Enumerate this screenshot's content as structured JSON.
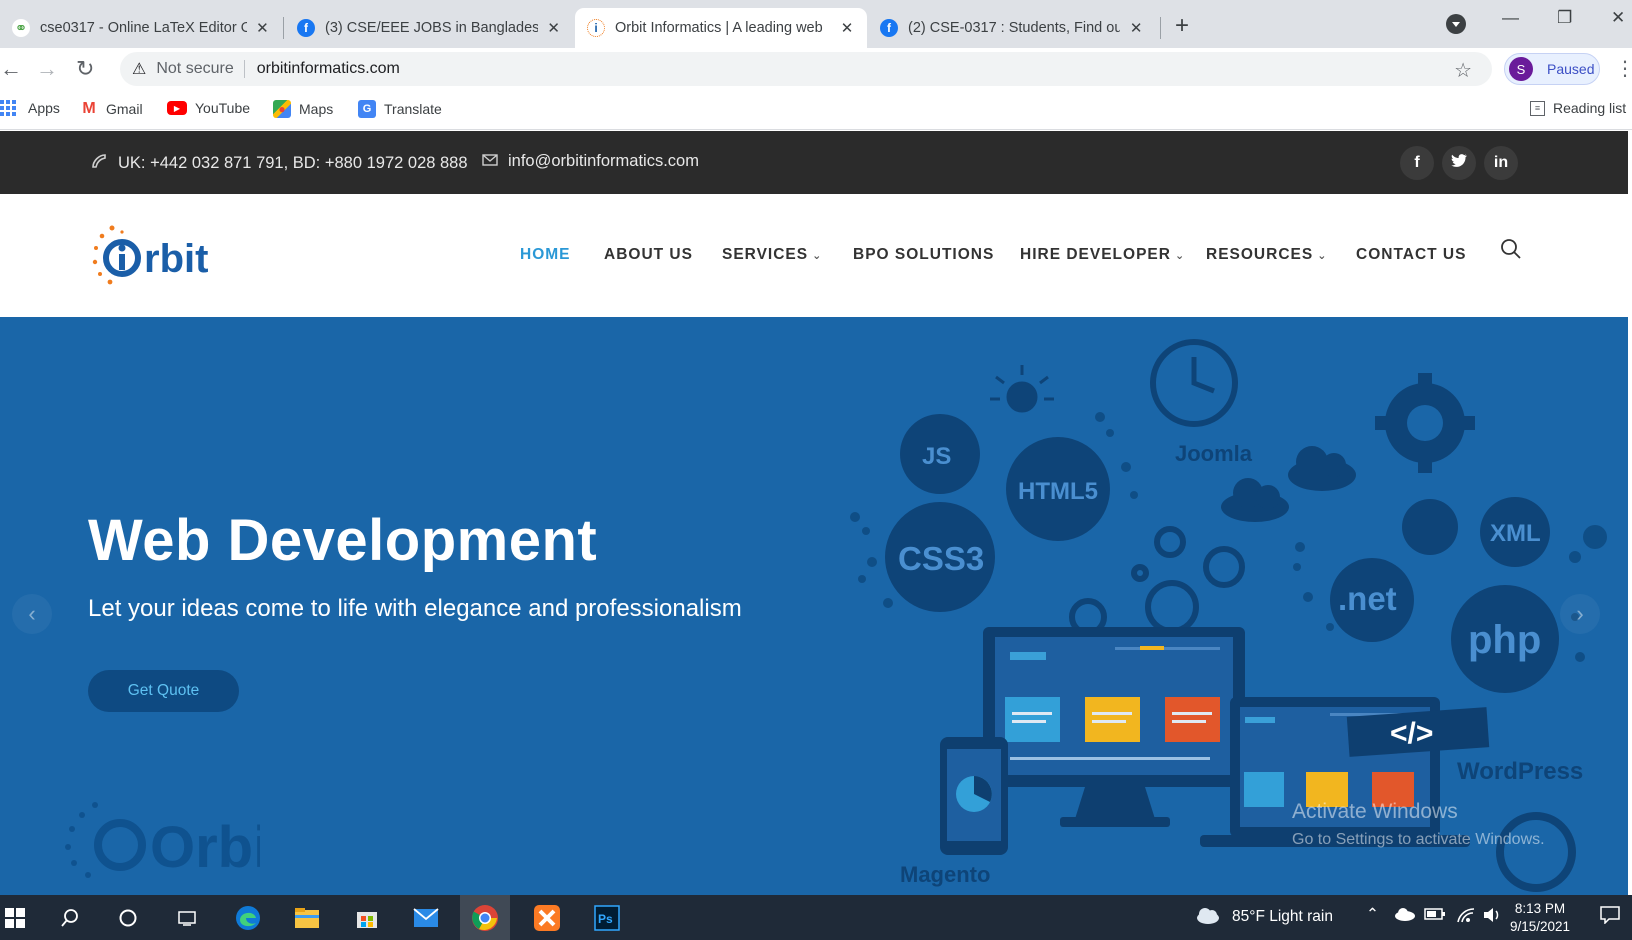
{
  "browser": {
    "tabs": [
      {
        "title": "cse0317 - Online LaTeX Editor Ov",
        "icon": "overleaf-icon",
        "active": false
      },
      {
        "title": "(3) CSE/EEE JOBS in Bangladesh :",
        "icon": "facebook-icon",
        "active": false
      },
      {
        "title": "Orbit Informatics | A leading web",
        "icon": "orbit-favicon",
        "active": true
      },
      {
        "title": "(2) CSE-0317 : Students, Find out",
        "icon": "facebook-icon",
        "active": false
      }
    ],
    "new_tab": "+",
    "security_label": "Not secure",
    "url": "orbitinformatics.com",
    "profile_initial": "S",
    "profile_status": "Paused",
    "bookmarks": [
      {
        "label": "Apps",
        "icon": "apps-grid-icon"
      },
      {
        "label": "Gmail",
        "icon": "gmail-icon"
      },
      {
        "label": "YouTube",
        "icon": "youtube-icon"
      },
      {
        "label": "Maps",
        "icon": "maps-icon"
      },
      {
        "label": "Translate",
        "icon": "translate-icon"
      }
    ],
    "reading_list": "Reading list"
  },
  "topbar": {
    "phone": "UK: +442 032 871 791, BD: +880 1972 028 888",
    "email": "info@orbitinformatics.com",
    "social": [
      {
        "label": "f",
        "icon": "facebook-icon"
      },
      {
        "label": "t",
        "icon": "twitter-icon"
      },
      {
        "label": "in",
        "icon": "linkedin-icon"
      }
    ]
  },
  "header": {
    "logo_text": "Orbit",
    "nav": [
      {
        "label": "HOME",
        "active": true,
        "dropdown": false
      },
      {
        "label": "ABOUT US",
        "active": false,
        "dropdown": false
      },
      {
        "label": "SERVICES",
        "active": false,
        "dropdown": true
      },
      {
        "label": "BPO SOLUTIONS",
        "active": false,
        "dropdown": false
      },
      {
        "label": "HIRE DEVELOPER",
        "active": false,
        "dropdown": true
      },
      {
        "label": "RESOURCES",
        "active": false,
        "dropdown": true
      },
      {
        "label": "CONTACT US",
        "active": false,
        "dropdown": false
      }
    ]
  },
  "hero": {
    "title": "Web Development",
    "subtitle": "Let your ideas come to life with elegance and professionalism",
    "button": "Get Quote",
    "tech_labels": [
      "JS",
      "HTML5",
      "Joomla",
      "CSS3",
      "XML",
      ".net",
      "php",
      "WordPress",
      "Magento"
    ],
    "code_tag": "</>"
  },
  "watermark": {
    "line1": "Activate Windows",
    "line2": "Go to Settings to activate Windows."
  },
  "taskbar": {
    "weather": "85°F  Light rain",
    "time": "8:13 PM",
    "date": "9/15/2021"
  },
  "colors": {
    "accent": "#2a98d6",
    "hero_bg": "#1a66a8",
    "topbar_bg": "#2b2b2b",
    "logo_orange": "#f07c1e",
    "logo_blue": "#1a5ea8"
  }
}
